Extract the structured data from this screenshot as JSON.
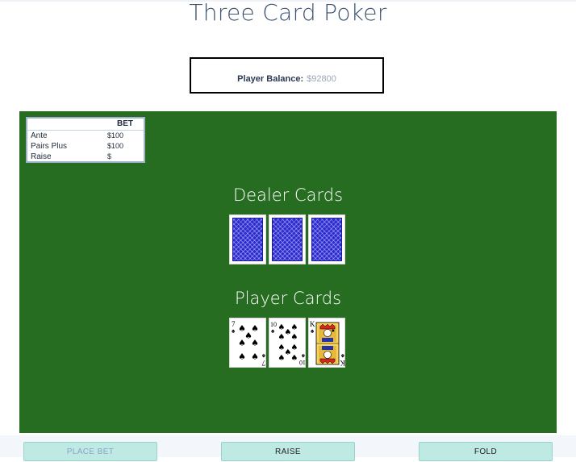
{
  "title": "Three Card Poker",
  "balance": {
    "label": "Player Balance:",
    "value": "$92800"
  },
  "bet_table": {
    "header": "BET",
    "rows": [
      {
        "label": "Ante",
        "value": "$100"
      },
      {
        "label": "Pairs Plus",
        "value": "$100"
      },
      {
        "label": "Raise",
        "value": "$"
      }
    ]
  },
  "dealer": {
    "title": "Dealer Cards",
    "cards": [
      "face-down",
      "face-down",
      "face-down"
    ]
  },
  "player": {
    "title": "Player Cards",
    "cards": [
      {
        "rank": "7",
        "suit": "spades"
      },
      {
        "rank": "10",
        "suit": "spades"
      },
      {
        "rank": "K",
        "suit": "spades"
      }
    ]
  },
  "buttons": {
    "place_bet": "PLACE BET",
    "raise": "RAISE",
    "fold": "FOLD"
  },
  "colors": {
    "felt": "#276d21",
    "card_back": "#2a2ad0",
    "button": "#bfe9e3"
  }
}
